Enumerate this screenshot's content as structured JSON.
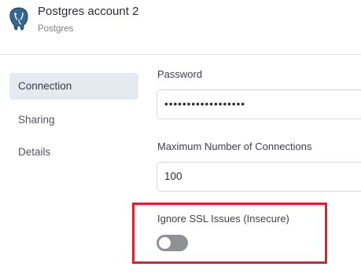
{
  "header": {
    "title": "Postgres account 2",
    "subtitle": "Postgres",
    "logo_icon": "postgresql-elephant-icon"
  },
  "sidebar": {
    "items": [
      {
        "label": "Connection",
        "active": true
      },
      {
        "label": "Sharing",
        "active": false
      },
      {
        "label": "Details",
        "active": false
      }
    ]
  },
  "form": {
    "password": {
      "label": "Password",
      "value": "••••••••••••••••••"
    },
    "max_connections": {
      "label": "Maximum Number of Connections",
      "value": "100"
    },
    "ignore_ssl": {
      "label": "Ignore SSL Issues (Insecure)",
      "enabled": false
    }
  },
  "colors": {
    "highlight_border": "#e0202a",
    "active_nav_bg": "#e5e9f0",
    "toggle_off": "#909096"
  }
}
